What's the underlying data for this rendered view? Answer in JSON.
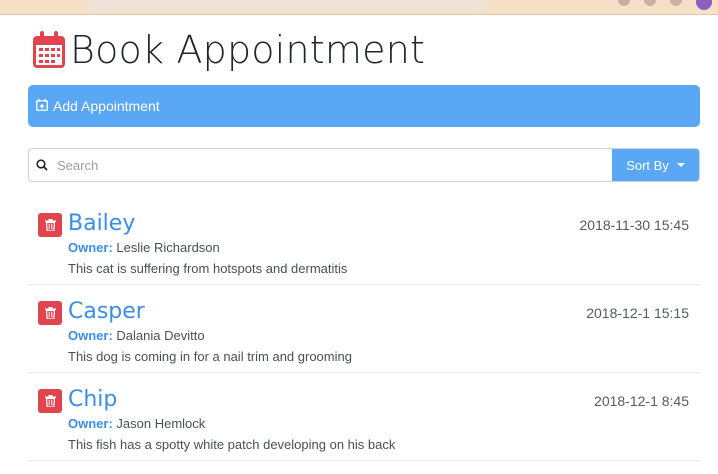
{
  "page": {
    "title": "Book Appointment"
  },
  "add_button": {
    "label": "Add Appointment"
  },
  "search": {
    "placeholder": "Search",
    "sort_label": "Sort By"
  },
  "appointments": [
    {
      "pet": "Bailey",
      "date": "2018-11-30 15:45",
      "owner_label": "Owner:",
      "owner": "Leslie Richardson",
      "notes": "This cat is suffering from hotspots and dermatitis"
    },
    {
      "pet": "Casper",
      "date": "2018-12-1 15:15",
      "owner_label": "Owner:",
      "owner": "Dalania Devitto",
      "notes": "This dog is coming in for a nail trim and grooming"
    },
    {
      "pet": "Chip",
      "date": "2018-12-1 8:45",
      "owner_label": "Owner:",
      "owner": "Jason Hemlock",
      "notes": "This fish has a spotty white patch developing on his back"
    }
  ],
  "colors": {
    "primary": "#5aa8f5",
    "link": "#3b8ee8",
    "danger": "#e0444f",
    "calendar_icon": "#e0444f"
  },
  "icons": {
    "title": "calendar-icon",
    "add": "calendar-plus-icon",
    "search": "search-icon",
    "delete": "trash-icon"
  }
}
